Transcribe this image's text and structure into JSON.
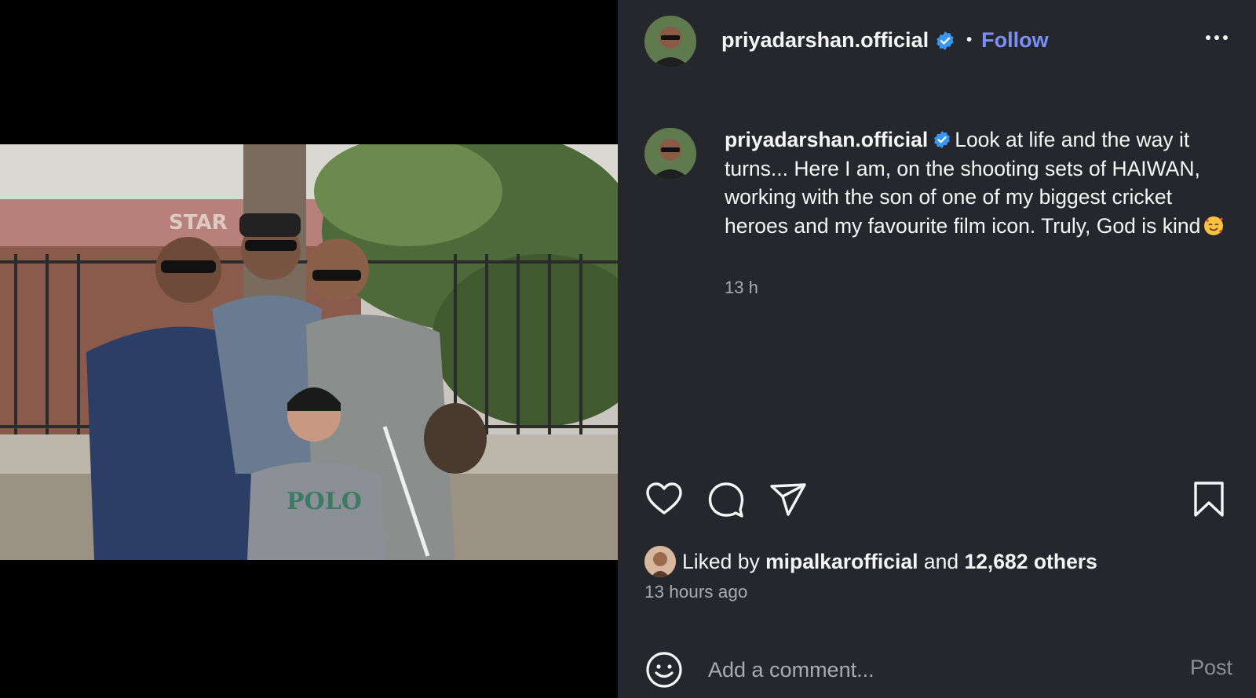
{
  "media": {
    "photo_description_icon": "group-photo",
    "sign_text": "STAR",
    "shirt_text": "POLO"
  },
  "header": {
    "username": "priyadarshan.official",
    "separator": "•",
    "follow_label": "Follow",
    "avatar_icon": "profile-avatar",
    "verified_icon": "verified-badge-icon",
    "more_icon": "more-options-icon"
  },
  "caption": {
    "username": "priyadarshan.official",
    "text": "Look at life and the way it turns... Here I am, on the shooting sets of HAIWAN, working with the son of one of my biggest cricket heroes and my favourite film icon. Truly, God is kind",
    "emoji_icon": "smiling-face-with-hearts-emoji",
    "time": "13 h"
  },
  "actions": {
    "like_icon": "heart-icon",
    "comment_icon": "comment-icon",
    "share_icon": "send-icon",
    "save_icon": "bookmark-icon"
  },
  "likes": {
    "prefix": "Liked by",
    "liker": "mipalkarofficial",
    "and": "and",
    "others": "12,682 others",
    "time": "13 hours ago"
  },
  "comment": {
    "placeholder": "Add a comment...",
    "post_label": "Post",
    "emoji_icon": "smiley-icon"
  },
  "colors": {
    "panel_bg": "#26272c",
    "accent_link": "#7b8ff7",
    "verified_blue": "#3897f0",
    "muted_text": "#a9abb0"
  }
}
